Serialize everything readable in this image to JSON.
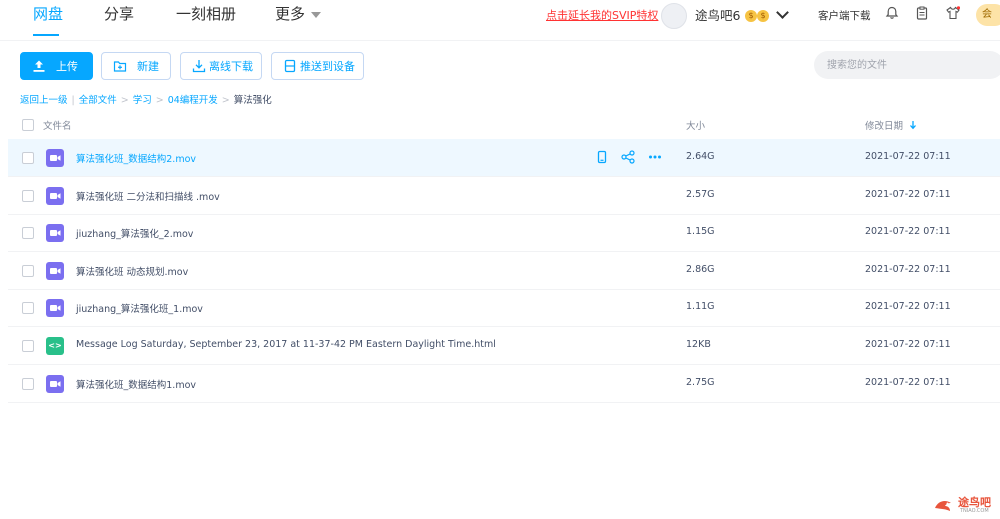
{
  "topnav": {
    "items": [
      {
        "label": "网盘",
        "active": true
      },
      {
        "label": "分享",
        "active": false
      },
      {
        "label": "一刻相册",
        "active": false
      },
      {
        "label": "更多",
        "active": false
      }
    ],
    "promo_link": "点击延长我的SVIP特权",
    "username": "途鸟吧6",
    "coin_a": "$",
    "coin_b": "$",
    "client_download": "客户端下载",
    "vip_tag": "会"
  },
  "toolbar": {
    "upload": "上传",
    "new": "新建",
    "offline_download": "离线下载",
    "push_device": "推送到设备"
  },
  "search": {
    "placeholder": "搜索您的文件"
  },
  "breadcrumb": {
    "back": "返回上一级",
    "all": "全部文件",
    "l1": "学习",
    "l2": "04编程开发",
    "current": "算法强化"
  },
  "table": {
    "col_name": "文件名",
    "col_size": "大小",
    "col_date": "修改日期",
    "rows": [
      {
        "name": "算法强化班_数据结构2.mov",
        "size": "2.64G",
        "date": "2021-07-22 07:11",
        "type": "video"
      },
      {
        "name": "算法强化班 二分法和扫描线 .mov",
        "size": "2.57G",
        "date": "2021-07-22 07:11",
        "type": "video"
      },
      {
        "name": "jiuzhang_算法强化_2.mov",
        "size": "1.15G",
        "date": "2021-07-22 07:11",
        "type": "video"
      },
      {
        "name": "算法强化班 动态规划.mov",
        "size": "2.86G",
        "date": "2021-07-22 07:11",
        "type": "video"
      },
      {
        "name": "jiuzhang_算法强化班_1.mov",
        "size": "1.11G",
        "date": "2021-07-22 07:11",
        "type": "video"
      },
      {
        "name": "Message Log Saturday, September 23, 2017 at 11-37-42 PM Eastern Daylight Time.html",
        "size": "12KB",
        "date": "2021-07-22 07:11",
        "type": "html"
      },
      {
        "name": "算法强化班_数据结构1.mov",
        "size": "2.75G",
        "date": "2021-07-22 07:11",
        "type": "video"
      }
    ]
  },
  "watermark": {
    "text": "途鸟吧",
    "sub": "TNIAO.COM"
  },
  "colors": {
    "accent": "#06a7ff",
    "video_icon": "#7b6ff0",
    "html_icon": "#29c08a",
    "promo": "#ff3333"
  }
}
